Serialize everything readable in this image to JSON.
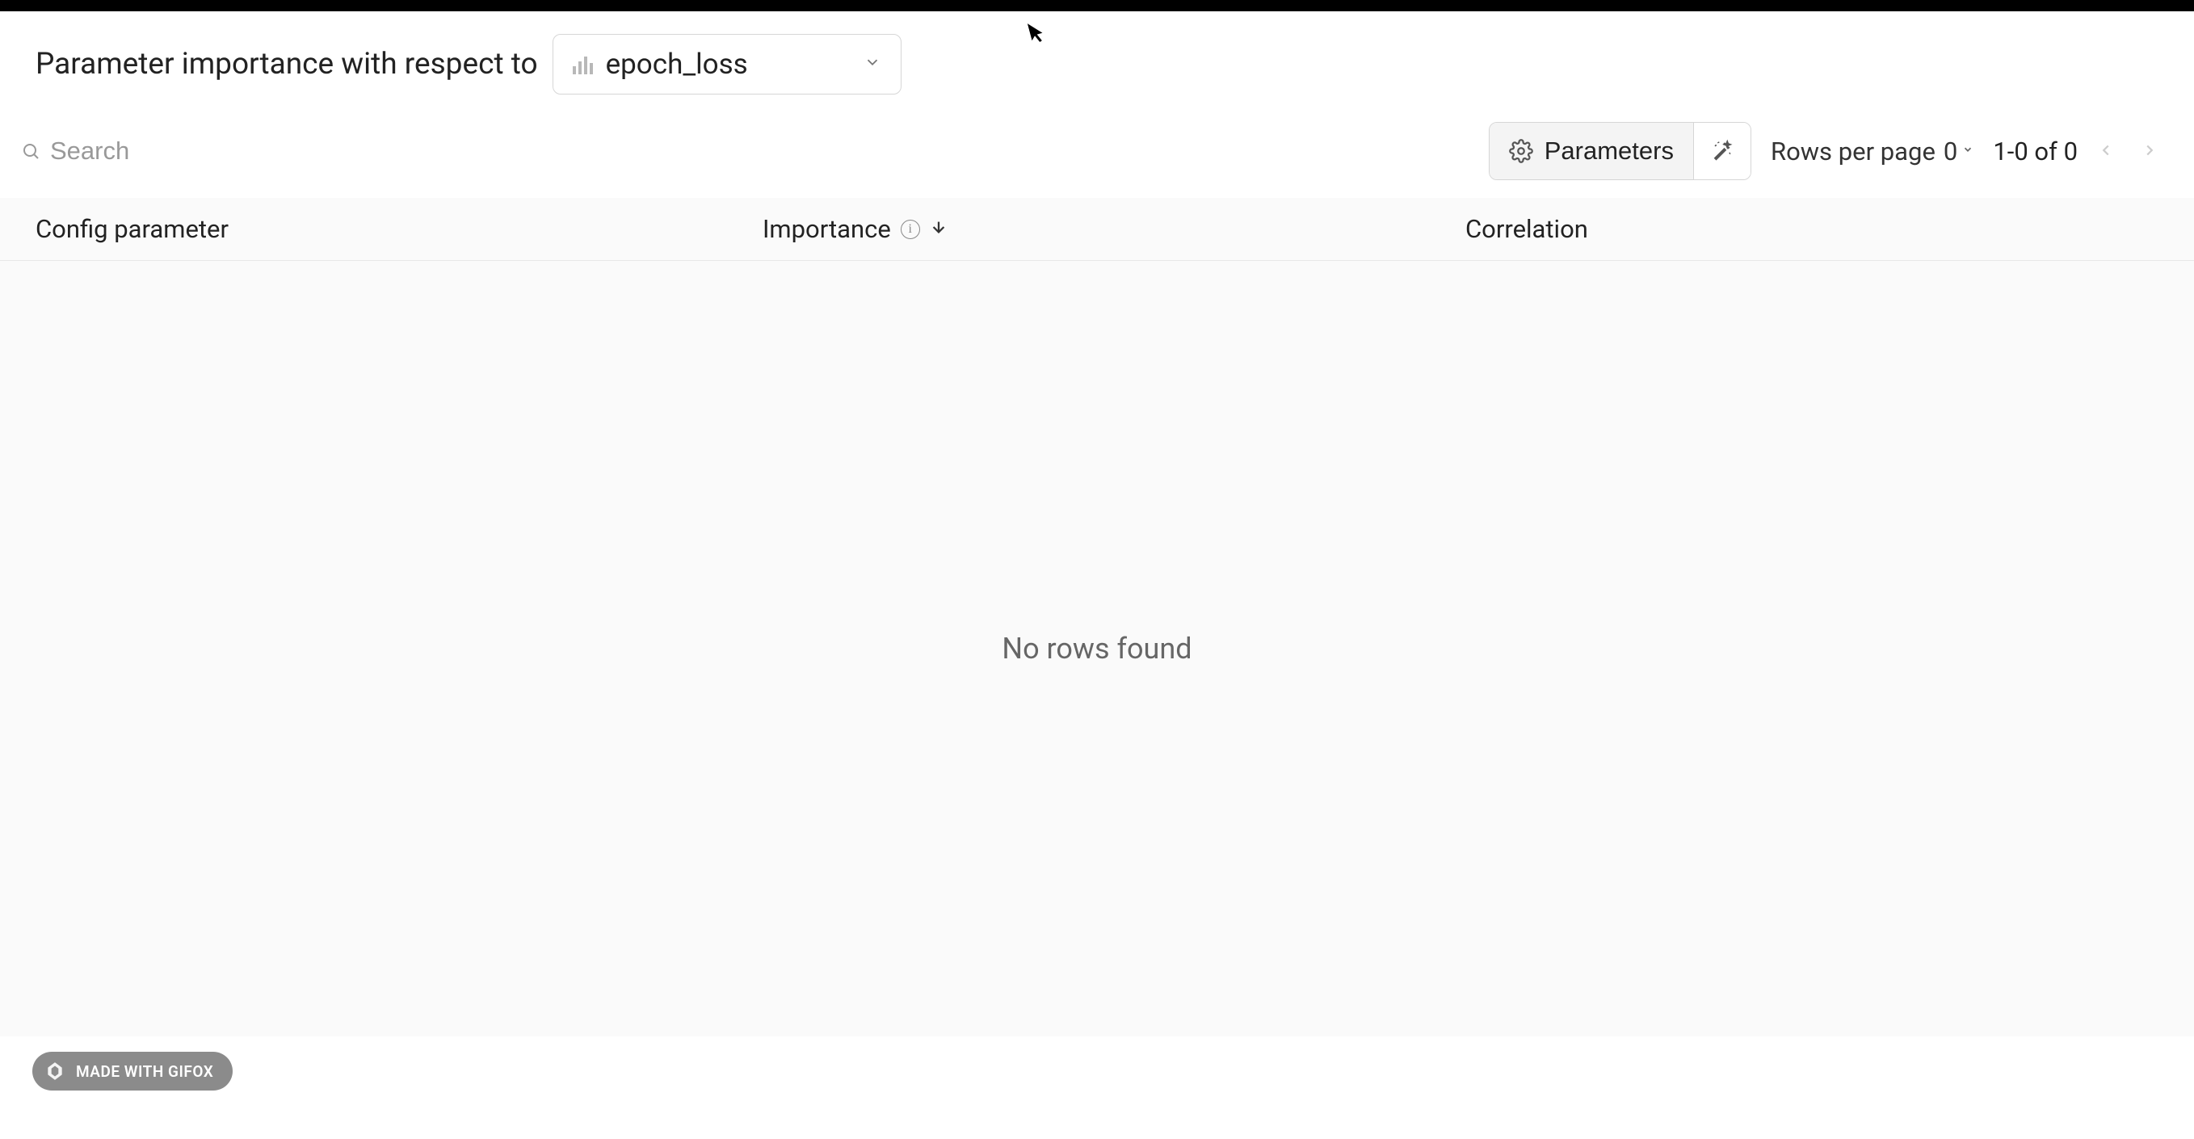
{
  "header": {
    "title": "Parameter importance with respect to",
    "metric_selected": "epoch_loss"
  },
  "toolbar": {
    "search_placeholder": "Search",
    "parameters_label": "Parameters",
    "rows_per_page_label": "Rows per page",
    "rows_per_page_value": "0",
    "page_info": "1-0 of 0"
  },
  "columns": {
    "config": "Config parameter",
    "importance": "Importance",
    "correlation": "Correlation"
  },
  "empty_state": "No rows found",
  "badge": {
    "text": "MADE WITH GIFOX"
  }
}
